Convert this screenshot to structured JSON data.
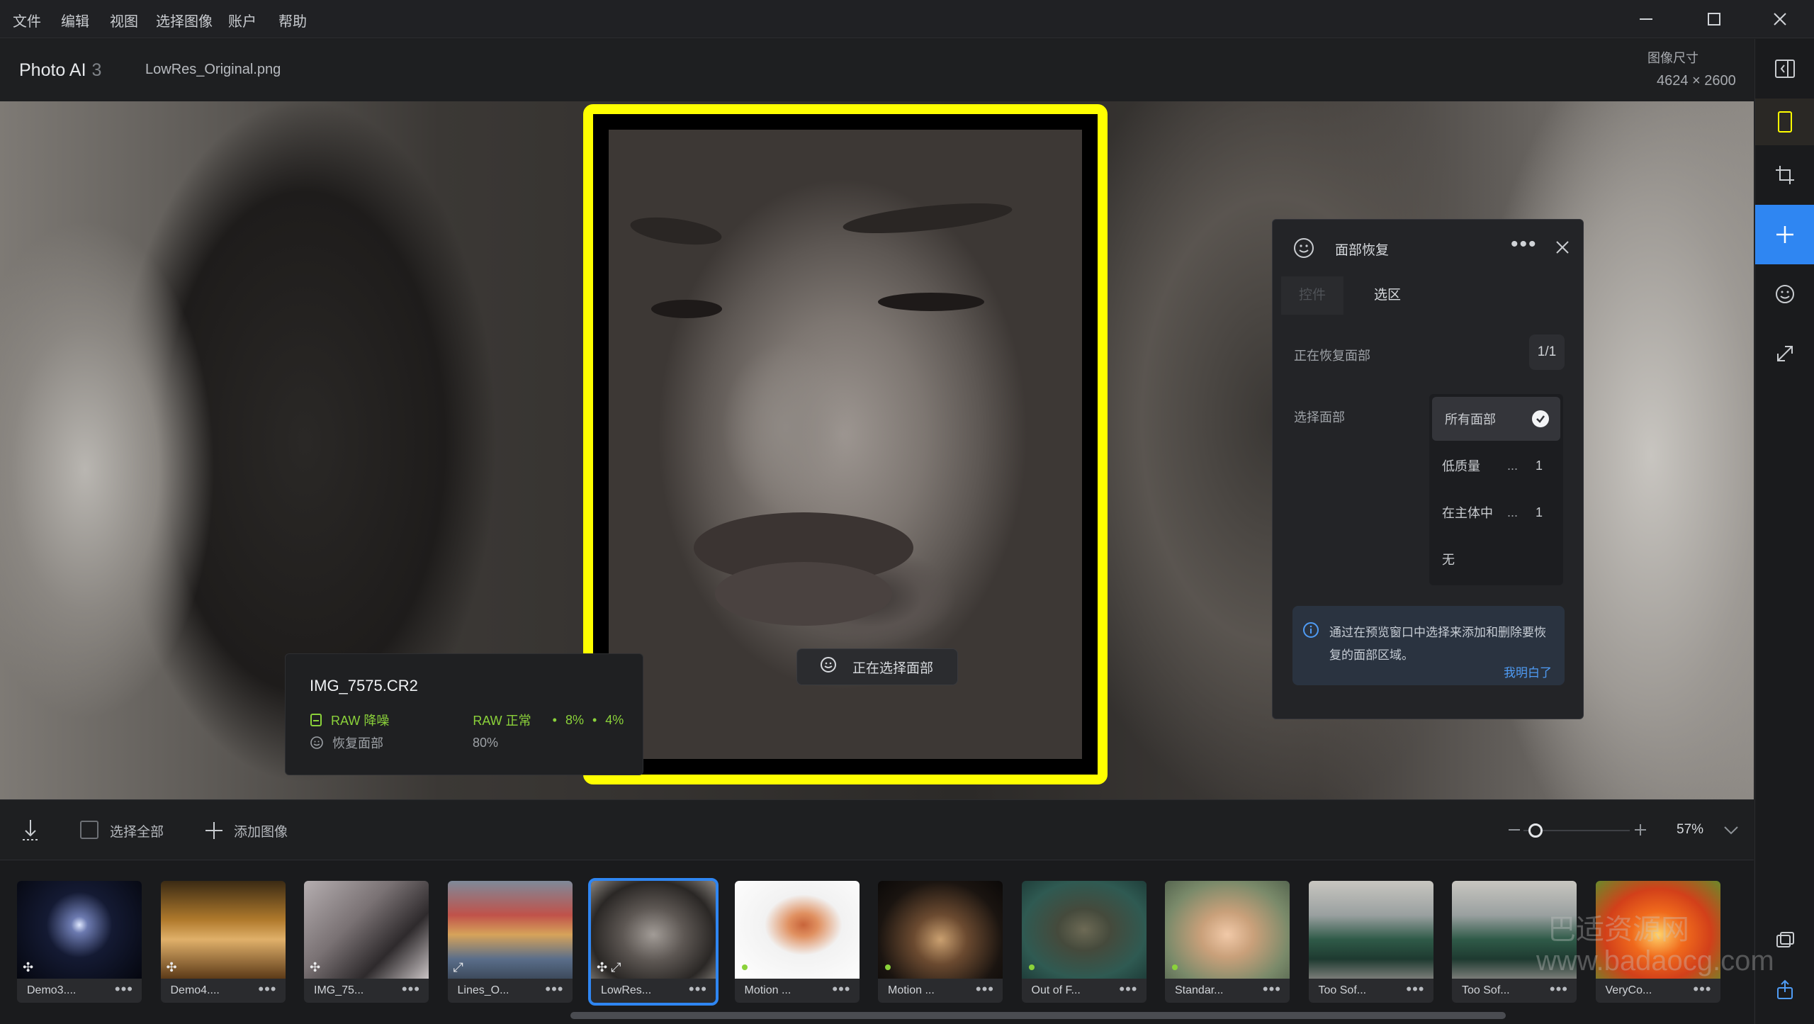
{
  "menu": [
    "文件",
    "编辑",
    "视图",
    "选择图像",
    "账户",
    "帮助"
  ],
  "header": {
    "app_name": "Photo AI",
    "app_version": "3",
    "file_name": "LowRes_Original.png",
    "dim_label": "图像尺寸",
    "dim_value": "4624 × 2600"
  },
  "canvas": {
    "selecting_label": "正在选择面部"
  },
  "info_card": {
    "title": "IMG_7575.CR2",
    "raw_denoise": "RAW 降噪",
    "raw_normal": "RAW 正常",
    "pct_a": "8%",
    "pct_b": "4%",
    "face_recovery": "恢复面部",
    "face_value": "80%"
  },
  "panel": {
    "title": "面部恢复",
    "tab_controls": "控件",
    "tab_selection": "选区",
    "recovering_label": "正在恢复面部",
    "recovering_count": "1/1",
    "select_label": "选择面部",
    "options": [
      {
        "label": "所有面部",
        "dots": "",
        "count": "",
        "selected": true
      },
      {
        "label": "低质量",
        "dots": "...",
        "count": "1",
        "selected": false
      },
      {
        "label": "在主体中",
        "dots": "...",
        "count": "1",
        "selected": false
      },
      {
        "label": "无",
        "dots": "",
        "count": "",
        "selected": false
      }
    ],
    "hint_text": "通过在预览窗口中选择来添加和删除要恢复的面部区域。",
    "hint_link": "我明白了"
  },
  "toolbar": {
    "select_all": "选择全部",
    "add_image": "添加图像",
    "zoom": "57%"
  },
  "filmstrip": [
    {
      "label": "Demo3....",
      "badge": "✣",
      "dot": false,
      "active": false
    },
    {
      "label": "Demo4....",
      "badge": "✣",
      "dot": false,
      "active": false
    },
    {
      "label": "IMG_75...",
      "badge": "✣",
      "dot": false,
      "active": false
    },
    {
      "label": "Lines_O...",
      "badge": "⤢",
      "dot": false,
      "active": false
    },
    {
      "label": "LowRes...",
      "badge": "✣ ⤢",
      "dot": false,
      "active": true
    },
    {
      "label": "Motion ...",
      "badge": "",
      "dot": true,
      "active": false
    },
    {
      "label": "Motion ...",
      "badge": "",
      "dot": true,
      "active": false
    },
    {
      "label": "Out of F...",
      "badge": "",
      "dot": true,
      "active": false
    },
    {
      "label": "Standar...",
      "badge": "",
      "dot": true,
      "active": false
    },
    {
      "label": "Too Sof...",
      "badge": "",
      "dot": false,
      "active": false
    },
    {
      "label": "Too Sof...",
      "badge": "",
      "dot": false,
      "active": false
    },
    {
      "label": "VeryCo...",
      "badge": "",
      "dot": false,
      "active": false
    }
  ],
  "watermark": [
    "巴适资源网",
    "www.badaocg.com"
  ],
  "colors": {
    "accent": "#2f86f2",
    "selection": "#ffff00",
    "ok_green": "#8bd23a"
  }
}
